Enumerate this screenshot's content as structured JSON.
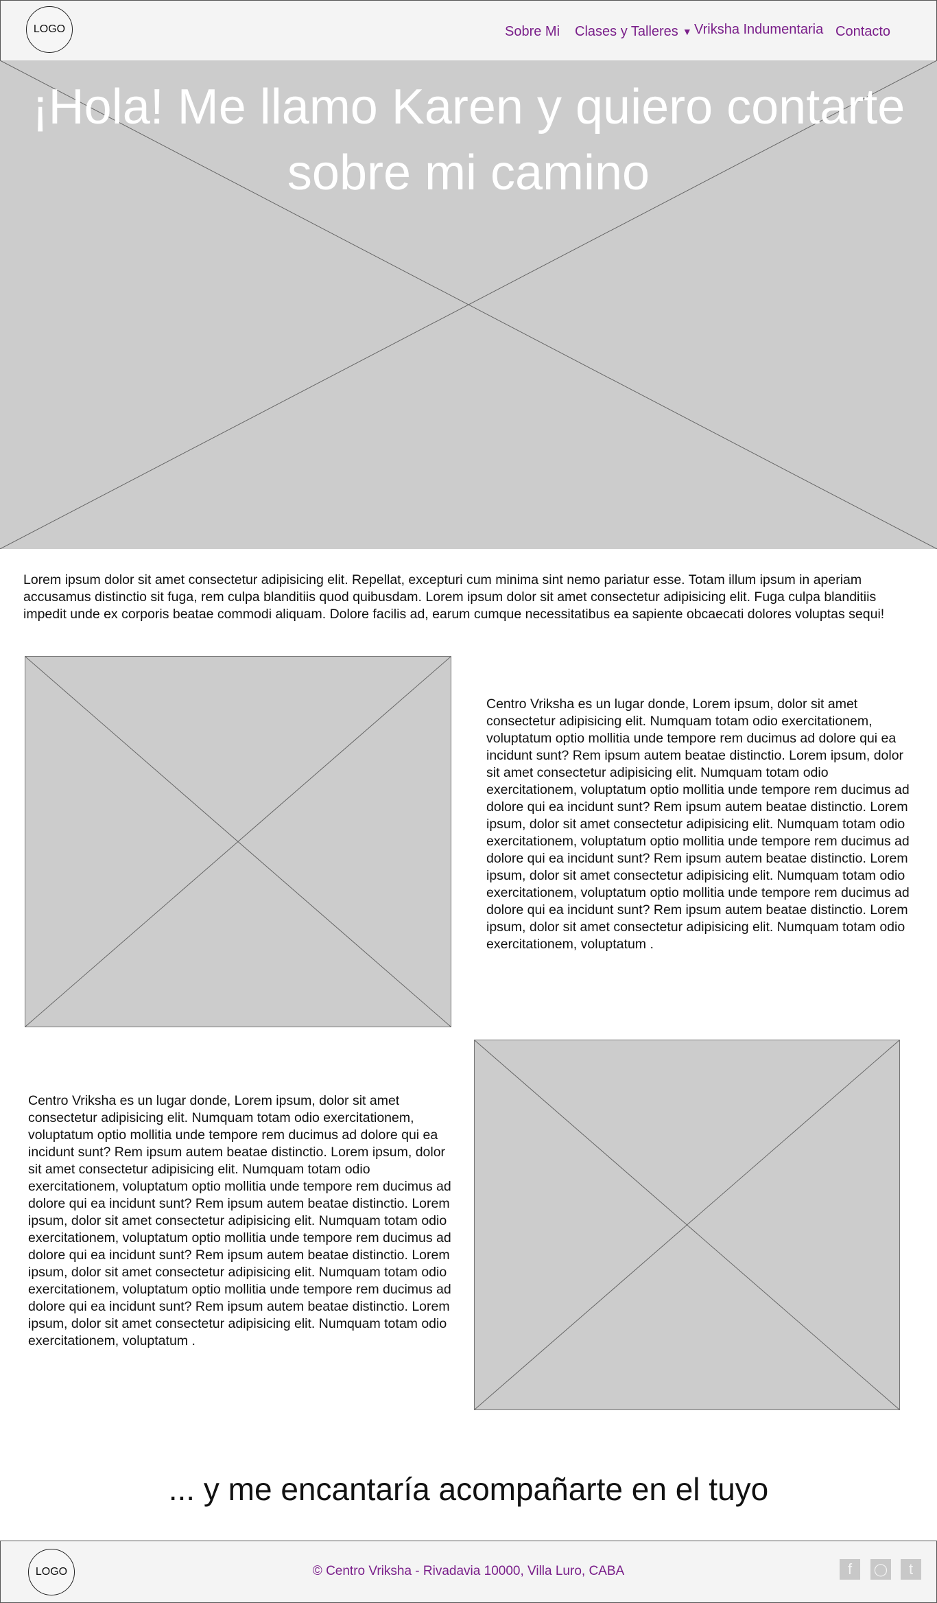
{
  "header": {
    "logo": "LOGO",
    "nav": [
      {
        "label": "Sobre Mi"
      },
      {
        "label": "Clases y Talleres"
      },
      {
        "label": "Vriksha Indumentaria"
      },
      {
        "label": "Contacto"
      }
    ]
  },
  "hero": {
    "title_line1": "¡Hola! Me llamo Karen y quiero contarte",
    "title_line2": "sobre mi camino"
  },
  "intro": "Lorem ipsum dolor sit amet consectetur adipisicing elit. Repellat, excepturi cum minima sint nemo pariatur esse. Totam illum ipsum in aperiam accusamus distinctio sit fuga, rem culpa blanditiis quod quibusdam. Lorem ipsum dolor sit amet consectetur adipisicing elit. Fuga culpa blanditiis impedit unde ex corporis beatae commodi aliquam. Dolore facilis ad, earum cumque necessitatibus ea sapiente obcaecati dolores voluptas sequi!",
  "section1": {
    "text": "Centro Vriksha es un lugar donde, Lorem ipsum, dolor sit amet consectetur adipisicing elit. Numquam totam odio exercitationem, voluptatum optio mollitia unde tempore rem ducimus ad dolore qui ea incidunt sunt? Rem ipsum autem beatae distinctio. Lorem ipsum, dolor sit amet consectetur adipisicing elit. Numquam totam odio exercitationem, voluptatum optio mollitia unde tempore rem ducimus ad dolore qui ea incidunt sunt? Rem ipsum autem beatae distinctio. Lorem ipsum, dolor sit amet consectetur adipisicing elit. Numquam totam odio exercitationem, voluptatum optio mollitia unde tempore rem ducimus ad dolore qui ea incidunt sunt? Rem ipsum autem beatae distinctio. Lorem ipsum, dolor sit amet consectetur adipisicing elit. Numquam totam odio exercitationem, voluptatum optio mollitia unde tempore rem ducimus ad dolore qui ea incidunt sunt? Rem ipsum autem beatae distinctio. Lorem ipsum, dolor sit amet consectetur adipisicing elit. Numquam totam odio exercitationem, voluptatum ."
  },
  "section2": {
    "text": "Centro Vriksha es un lugar donde, Lorem ipsum, dolor sit amet consectetur adipisicing elit. Numquam totam odio exercitationem, voluptatum optio mollitia unde tempore rem ducimus ad dolore qui ea incidunt sunt? Rem ipsum autem beatae distinctio. Lorem ipsum, dolor sit amet consectetur adipisicing elit. Numquam totam odio exercitationem, voluptatum optio mollitia unde tempore rem ducimus ad dolore qui ea incidunt sunt? Rem ipsum autem beatae distinctio. Lorem ipsum, dolor sit amet consectetur adipisicing elit. Numquam totam odio exercitationem, voluptatum optio mollitia unde tempore rem ducimus ad dolore qui ea incidunt sunt? Rem ipsum autem beatae distinctio. Lorem ipsum, dolor sit amet consectetur adipisicing elit. Numquam totam odio exercitationem, voluptatum optio mollitia unde tempore rem ducimus ad dolore qui ea incidunt sunt? Rem ipsum autem beatae distinctio. Lorem ipsum, dolor sit amet consectetur adipisicing elit. Numquam totam odio exercitationem, voluptatum ."
  },
  "closing": "... y me encantaría acompañarte en el tuyo",
  "footer": {
    "logo": "LOGO",
    "text": "© Centro Vriksha - Rivadavia 10000, Villa Luro, CABA",
    "social": [
      {
        "icon": "facebook-icon",
        "glyph": "f"
      },
      {
        "icon": "instagram-icon",
        "glyph": "◯"
      },
      {
        "icon": "tumblr-icon",
        "glyph": "t"
      }
    ]
  },
  "colors": {
    "accent": "#7a1f8a",
    "placeholder": "#cccccc",
    "bar": "#f4f4f4"
  }
}
